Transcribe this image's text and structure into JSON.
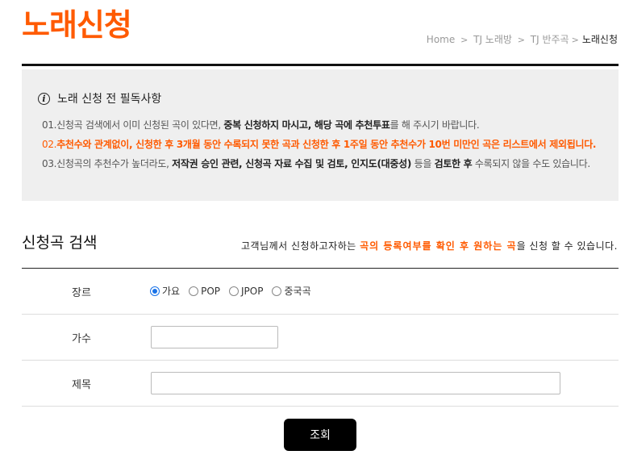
{
  "header": {
    "title": "노래신청",
    "breadcrumb": [
      "Home",
      "TJ 노래방",
      "TJ 반주곡",
      "노래신청"
    ]
  },
  "notice": {
    "heading": "노래 신청 전 필독사항",
    "icon": "info-icon",
    "line1": {
      "prefix": "01.신청곡 검색에서 이미 신청된 곡이 있다면, ",
      "bold1": "중복 신청하지 마시고, 해당 곡에 추천투표",
      "suffix": "를 해 주시기 바랍니다."
    },
    "line2": {
      "prefix": "02.",
      "text": "추천수와 관계없이, 신청한 후 3개월 동안 수록되지 못한 곡과 신청한 후 1주일 동안 추천수가 10번 미만인 곡은 리스트에서 제외됩니다."
    },
    "line3": {
      "prefix": "03.신청곡의 추천수가 높더라도, ",
      "bold1": "저작권 승인 관련, 신청곡 자료 수집 및 검토, 인지도(대중성)",
      "mid": " 등을 ",
      "bold2": "검토한 후",
      "suffix": " 수록되지 않을 수도 있습니다."
    },
    "accent_color": "#ff5a00"
  },
  "search": {
    "title": "신청곡 검색",
    "desc_prefix": "고객님께서 신청하고자하는 ",
    "desc_highlight": "곡의 등록여부를 확인 후 원하는 곡",
    "desc_suffix": "을 신청 할 수 있습니다.",
    "genre_label": "장르",
    "genres": [
      "가요",
      "POP",
      "JPOP",
      "중국곡"
    ],
    "selected_genre": "가요",
    "singer_label": "가수",
    "singer_value": "",
    "title_label": "제목",
    "title_value": "",
    "button_label": "조회"
  }
}
